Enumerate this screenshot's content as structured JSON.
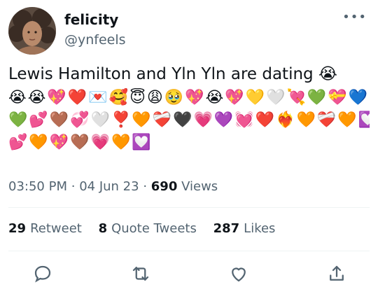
{
  "user": {
    "display_name": "felicity",
    "handle": "@ynfeels"
  },
  "tweet": {
    "text": "Lewis Hamilton and Yln Yln are dating",
    "text_emoji": "😭",
    "emoji_rows": [
      "😭😭💖❤️💌🥰😇😩🥹💖😭💖💛🤍💘💚💝💙",
      "💚💕🤎💞🤍❣️🧡❤️‍🩹🖤💗💜💓❤️❤️‍🔥🧡❤️‍🩹🧡💟",
      "💕🧡💖🤎💗🧡💟"
    ]
  },
  "meta": {
    "time": "03:50 PM",
    "separator": "·",
    "date": "04 Jun 23",
    "views_count": "690",
    "views_label": "Views"
  },
  "stats": {
    "retweets_count": "29",
    "retweets_label": "Retweet",
    "quotes_count": "8",
    "quotes_label": "Quote Tweets",
    "likes_count": "287",
    "likes_label": "Likes"
  },
  "more_label": "•••",
  "icons": [
    "more-icon",
    "reply-icon",
    "retweet-icon",
    "like-icon",
    "share-icon"
  ],
  "colors": {
    "text_primary": "#0f1419",
    "text_secondary": "#536471",
    "divider": "#eff3f4"
  }
}
